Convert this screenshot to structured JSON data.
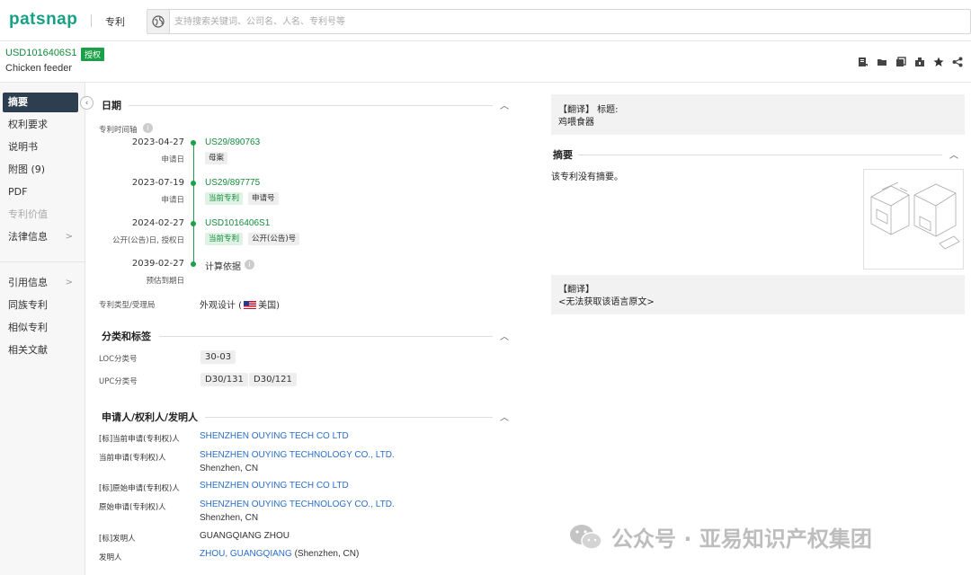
{
  "brand": {
    "logo": "patsnap",
    "nav_patent": "专利"
  },
  "search": {
    "placeholder": "支持搜索关键词、公司名、人名、专利号等"
  },
  "patent": {
    "number": "USD1016406S1",
    "status_badge": "授权",
    "title": "Chicken feeder"
  },
  "toolbar": {
    "icons": [
      "export-icon",
      "folder-icon",
      "copy-icon",
      "share-box-icon",
      "star-icon",
      "share-icon"
    ]
  },
  "sidebar": {
    "items": [
      {
        "label": "摘要",
        "active": true
      },
      {
        "label": "权利要求"
      },
      {
        "label": "说明书"
      },
      {
        "label": "附图 (9)"
      },
      {
        "label": "PDF"
      },
      {
        "label": "专利价值",
        "disabled": true
      },
      {
        "label": "法律信息",
        "chevron": ">"
      },
      {
        "label": "引用信息",
        "chevron": ">"
      },
      {
        "label": "同族专利"
      },
      {
        "label": "相似专利"
      },
      {
        "label": "相关文献"
      }
    ]
  },
  "dates": {
    "section_title": "日期",
    "timeline_label": "专利时间轴",
    "events": [
      {
        "date": "2023-04-27",
        "sub": "申请日",
        "link": "US29/890763",
        "tags": [
          {
            "text": "母案",
            "style": "gray"
          }
        ]
      },
      {
        "date": "2023-07-19",
        "sub": "申请日",
        "link": "US29/897775",
        "tags": [
          {
            "text": "当前专利",
            "style": "green"
          },
          {
            "text": "申请号",
            "style": "gray"
          }
        ]
      },
      {
        "date": "2024-02-27",
        "sub": "公开(公告)日, 授权日",
        "link": "USD1016406S1",
        "tags": [
          {
            "text": "当前专利",
            "style": "green"
          },
          {
            "text": "公开(公告)号",
            "style": "gray"
          }
        ]
      },
      {
        "date": "2039-02-27",
        "sub": "预估到期日",
        "text": "计算依据"
      }
    ],
    "type_label": "专利类型/受理局",
    "type_value_pre": "外观设计 (",
    "type_value_post": "美国)"
  },
  "classification": {
    "section_title": "分类和标签",
    "loc_label": "LOC分类号",
    "loc_values": [
      "30-03"
    ],
    "upc_label": "UPC分类号",
    "upc_values": [
      "D30/131",
      "D30/121"
    ]
  },
  "parties": {
    "section_title": "申请人/权利人/发明人",
    "rows": [
      {
        "label": "[标]当前申请(专利权)人",
        "value": "SHENZHEN OUYING TECH CO LTD"
      },
      {
        "label": "当前申请(专利权)人",
        "value": "SHENZHEN OUYING TECHNOLOGY CO., LTD.",
        "sub": "Shenzhen, CN"
      },
      {
        "label": "[标]原始申请(专利权)人",
        "value": "SHENZHEN OUYING TECH CO LTD"
      },
      {
        "label": "原始申请(专利权)人",
        "value": "SHENZHEN OUYING TECHNOLOGY CO., LTD.",
        "sub": "Shenzhen, CN"
      },
      {
        "label": "[标]发明人",
        "value": "GUANGQIANG ZHOU",
        "plain": true
      },
      {
        "label": "发明人",
        "value": "ZHOU, GUANGQIANG",
        "suffix": " (Shenzhen, CN)"
      }
    ]
  },
  "right": {
    "translate_title_label": "【翻译】 标题:",
    "translate_title_value": "鸡喂食器",
    "abstract_title": "摘要",
    "abstract_text": "该专利没有摘要。",
    "translate2_label": "【翻译】",
    "translate2_value": "<无法获取该语言原文>"
  },
  "watermark": {
    "text": "公众号 · 亚易知识产权集团"
  }
}
